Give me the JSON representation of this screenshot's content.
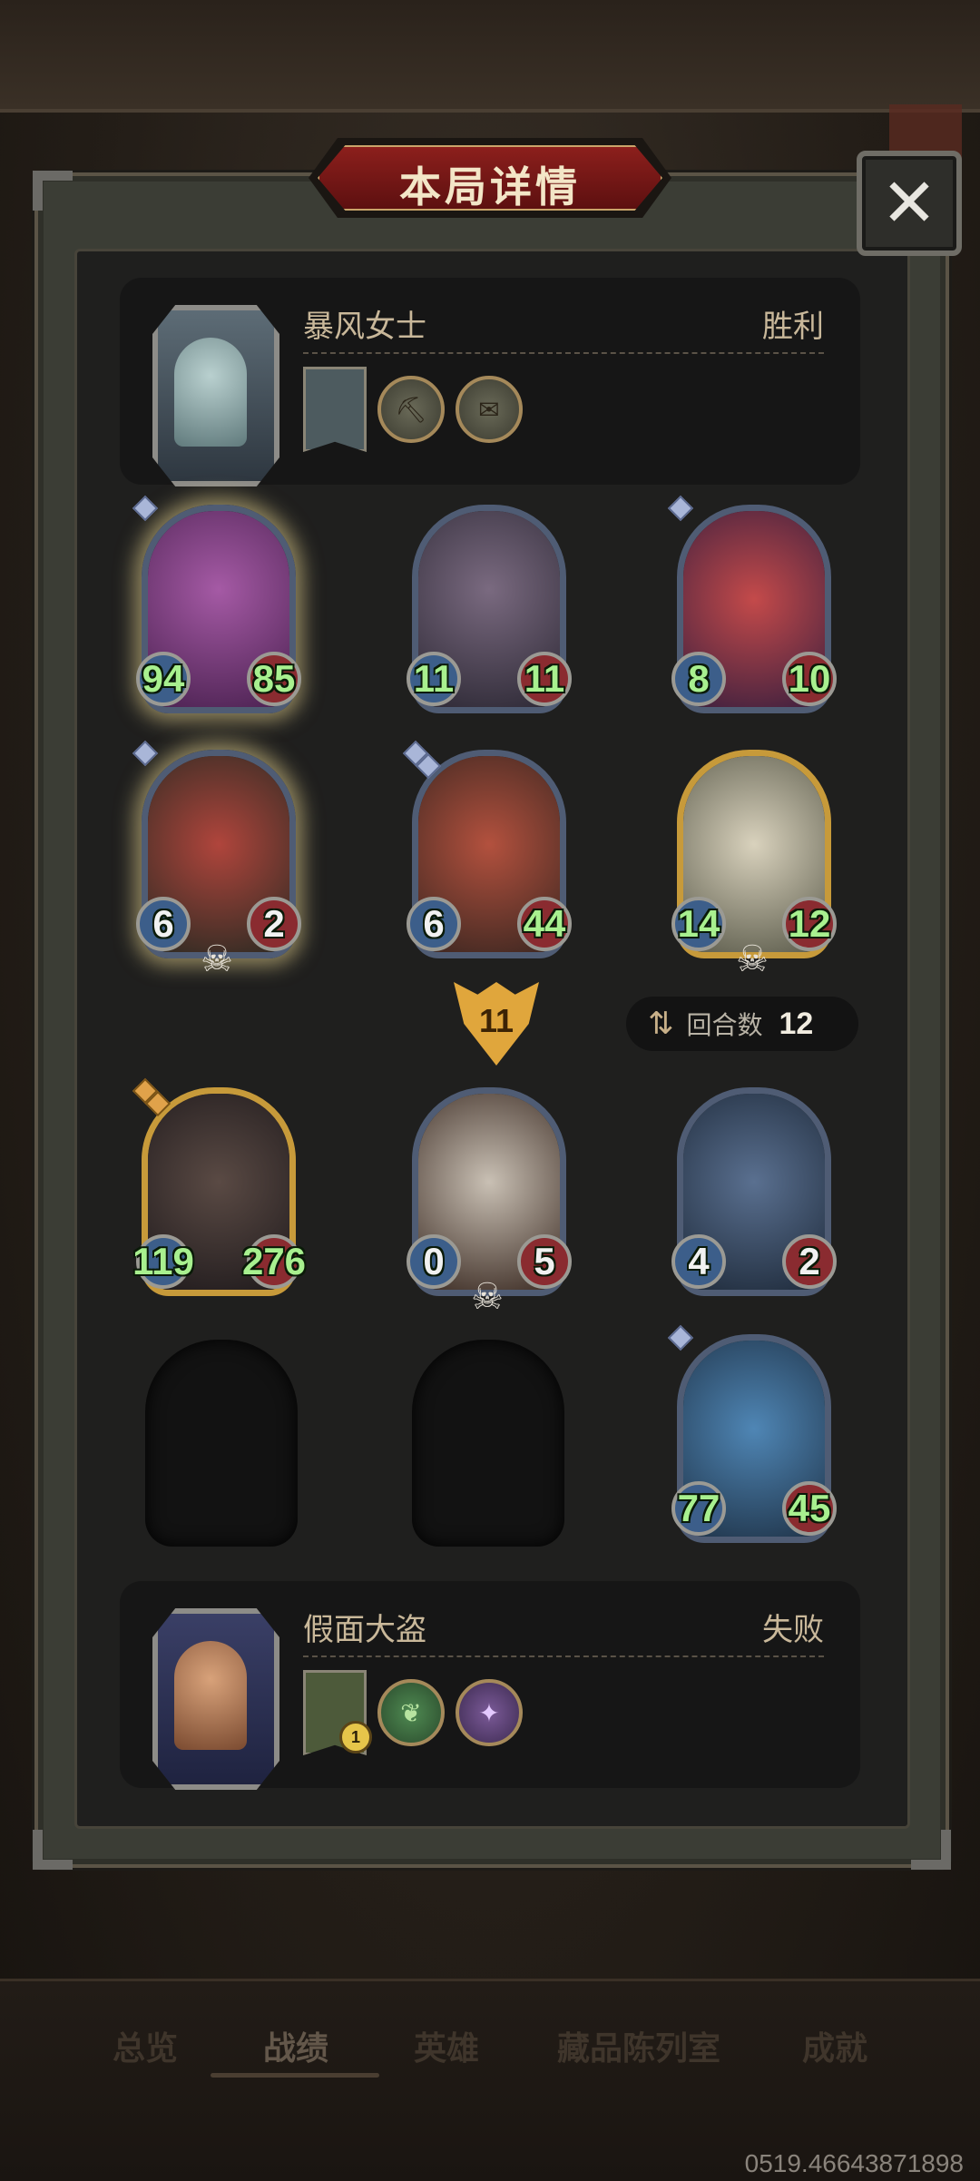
{
  "title": "本局详情",
  "close_label": "✕",
  "player_top": {
    "name": "暴风女士",
    "result": "胜利"
  },
  "player_bottom": {
    "name": "假面大盗",
    "result": "失败",
    "banner_badge": "1"
  },
  "top_board": [
    {
      "atk": "94",
      "hp": "85"
    },
    {
      "atk": "11",
      "hp": "11"
    },
    {
      "atk": "8",
      "hp": "10"
    },
    {
      "atk": "6",
      "hp": "2"
    },
    {
      "atk": "6",
      "hp": "44"
    },
    {
      "atk": "14",
      "hp": "12"
    }
  ],
  "bottom_board": [
    {
      "atk": "119",
      "hp": "276"
    },
    {
      "atk": "0",
      "hp": "5"
    },
    {
      "atk": "4",
      "hp": "2"
    },
    {
      "atk": "77",
      "hp": "45"
    }
  ],
  "turn_damage": "11",
  "round": {
    "label": "回合数",
    "value": "12"
  },
  "tabs": [
    "总览",
    "战绩",
    "英雄",
    "藏品陈列室",
    "成就"
  ],
  "uid": "0519.46643871898",
  "colors": {
    "title_red": "#8c1f1c",
    "stat_green": "#a8f08f",
    "gold_border": "#c79a3a"
  }
}
